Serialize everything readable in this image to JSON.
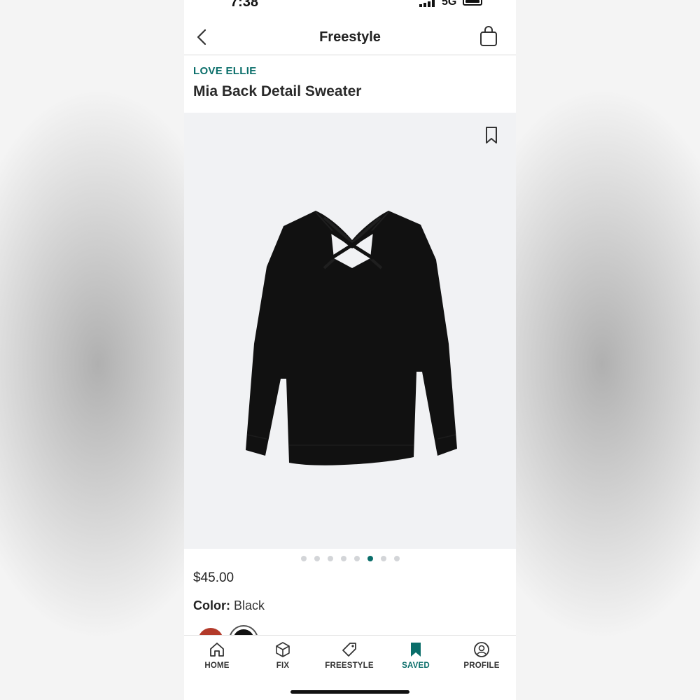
{
  "status_bar": {
    "time": "7:38",
    "network": "5G"
  },
  "header": {
    "title": "Freestyle",
    "icons": [
      "back-arrow-icon",
      "shopping-bag-icon"
    ]
  },
  "product": {
    "brand": "LOVE ELLIE",
    "name": "Mia Back Detail Sweater",
    "price": "$45.00",
    "color_label": "Color:",
    "color_value": "Black",
    "image_count": 8,
    "active_image_index": 6,
    "swatches": [
      {
        "name": "red",
        "color": "#b33a2a",
        "selected": false
      },
      {
        "name": "black",
        "color": "#111111",
        "selected": true
      }
    ]
  },
  "tab_bar": {
    "tabs": [
      {
        "label": "HOME",
        "icon": "home-icon",
        "active": false
      },
      {
        "label": "FIX",
        "icon": "box-icon",
        "active": false
      },
      {
        "label": "FREESTYLE",
        "icon": "tag-icon",
        "active": false
      },
      {
        "label": "SAVED",
        "icon": "bookmark-icon",
        "active": true
      },
      {
        "label": "PROFILE",
        "icon": "profile-icon",
        "active": false
      }
    ]
  },
  "colors": {
    "accent": "#0a6e6a",
    "image_background": "#f1f2f4"
  }
}
